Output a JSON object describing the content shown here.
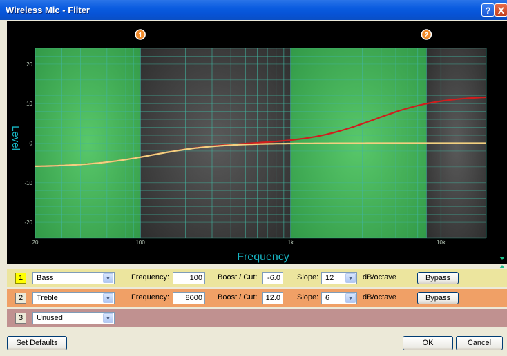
{
  "window": {
    "title": "Wireless Mic - Filter",
    "help_label": "?",
    "close_label": "X"
  },
  "plot": {
    "band_markers": [
      "1",
      "2"
    ],
    "y_axis_label": "Level",
    "x_axis_label": "Frequency",
    "y_ticks": [
      "20",
      "10",
      "0",
      "-10",
      "-20"
    ],
    "x_ticks": [
      "20",
      "100",
      "1k",
      "10k"
    ],
    "colors": {
      "background": "#000000",
      "grid": "#42b5a0",
      "band1_highlight": "#4cbf5c",
      "band2_highlight": "#4cbf5c",
      "axis_text": "#17b6c4",
      "band2_curve": "#d01d1d",
      "band1_curve": "#f2d080"
    },
    "band1": {
      "freq": 100,
      "gain": -6.0
    },
    "band2": {
      "freq": 8000,
      "gain": 12.0
    },
    "band2_range": [
      1000,
      8000
    ]
  },
  "bands": [
    {
      "number": "1",
      "type": "Bass",
      "frequency_label": "Frequency:",
      "frequency": "100",
      "boost_label": "Boost / Cut:",
      "boost": "-6.0",
      "slope_label": "Slope:",
      "slope": "12",
      "slope_unit": "dB/octave",
      "bypass_label": "Bypass"
    },
    {
      "number": "2",
      "type": "Treble",
      "frequency_label": "Frequency:",
      "frequency": "8000",
      "boost_label": "Boost / Cut:",
      "boost": "12.0",
      "slope_label": "Slope:",
      "slope": "6",
      "slope_unit": "dB/octave",
      "bypass_label": "Bypass"
    },
    {
      "number": "3",
      "type": "Unused"
    }
  ],
  "footer": {
    "set_defaults_label": "Set Defaults",
    "ok_label": "OK",
    "cancel_label": "Cancel"
  }
}
